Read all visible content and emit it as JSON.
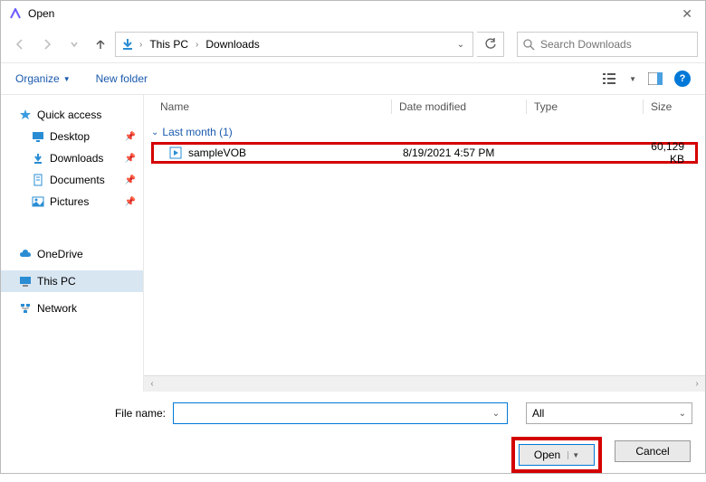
{
  "title": "Open",
  "breadcrumb": {
    "root": "This PC",
    "folder": "Downloads"
  },
  "search": {
    "placeholder": "Search Downloads"
  },
  "toolbar": {
    "organize": "Organize",
    "newfolder": "New folder"
  },
  "sidebar": {
    "quick": "Quick access",
    "desktop": "Desktop",
    "downloads": "Downloads",
    "documents": "Documents",
    "pictures": "Pictures",
    "onedrive": "OneDrive",
    "thispc": "This PC",
    "network": "Network"
  },
  "columns": {
    "name": "Name",
    "date": "Date modified",
    "type": "Type",
    "size": "Size"
  },
  "group": {
    "label": "Last month (1)"
  },
  "files": [
    {
      "name": "sampleVOB",
      "date": "8/19/2021 4:57 PM",
      "type": "",
      "size": "60,129 KB"
    }
  ],
  "footer": {
    "filename_label": "File name:",
    "filename_value": "",
    "filter": "All",
    "open": "Open",
    "cancel": "Cancel"
  }
}
